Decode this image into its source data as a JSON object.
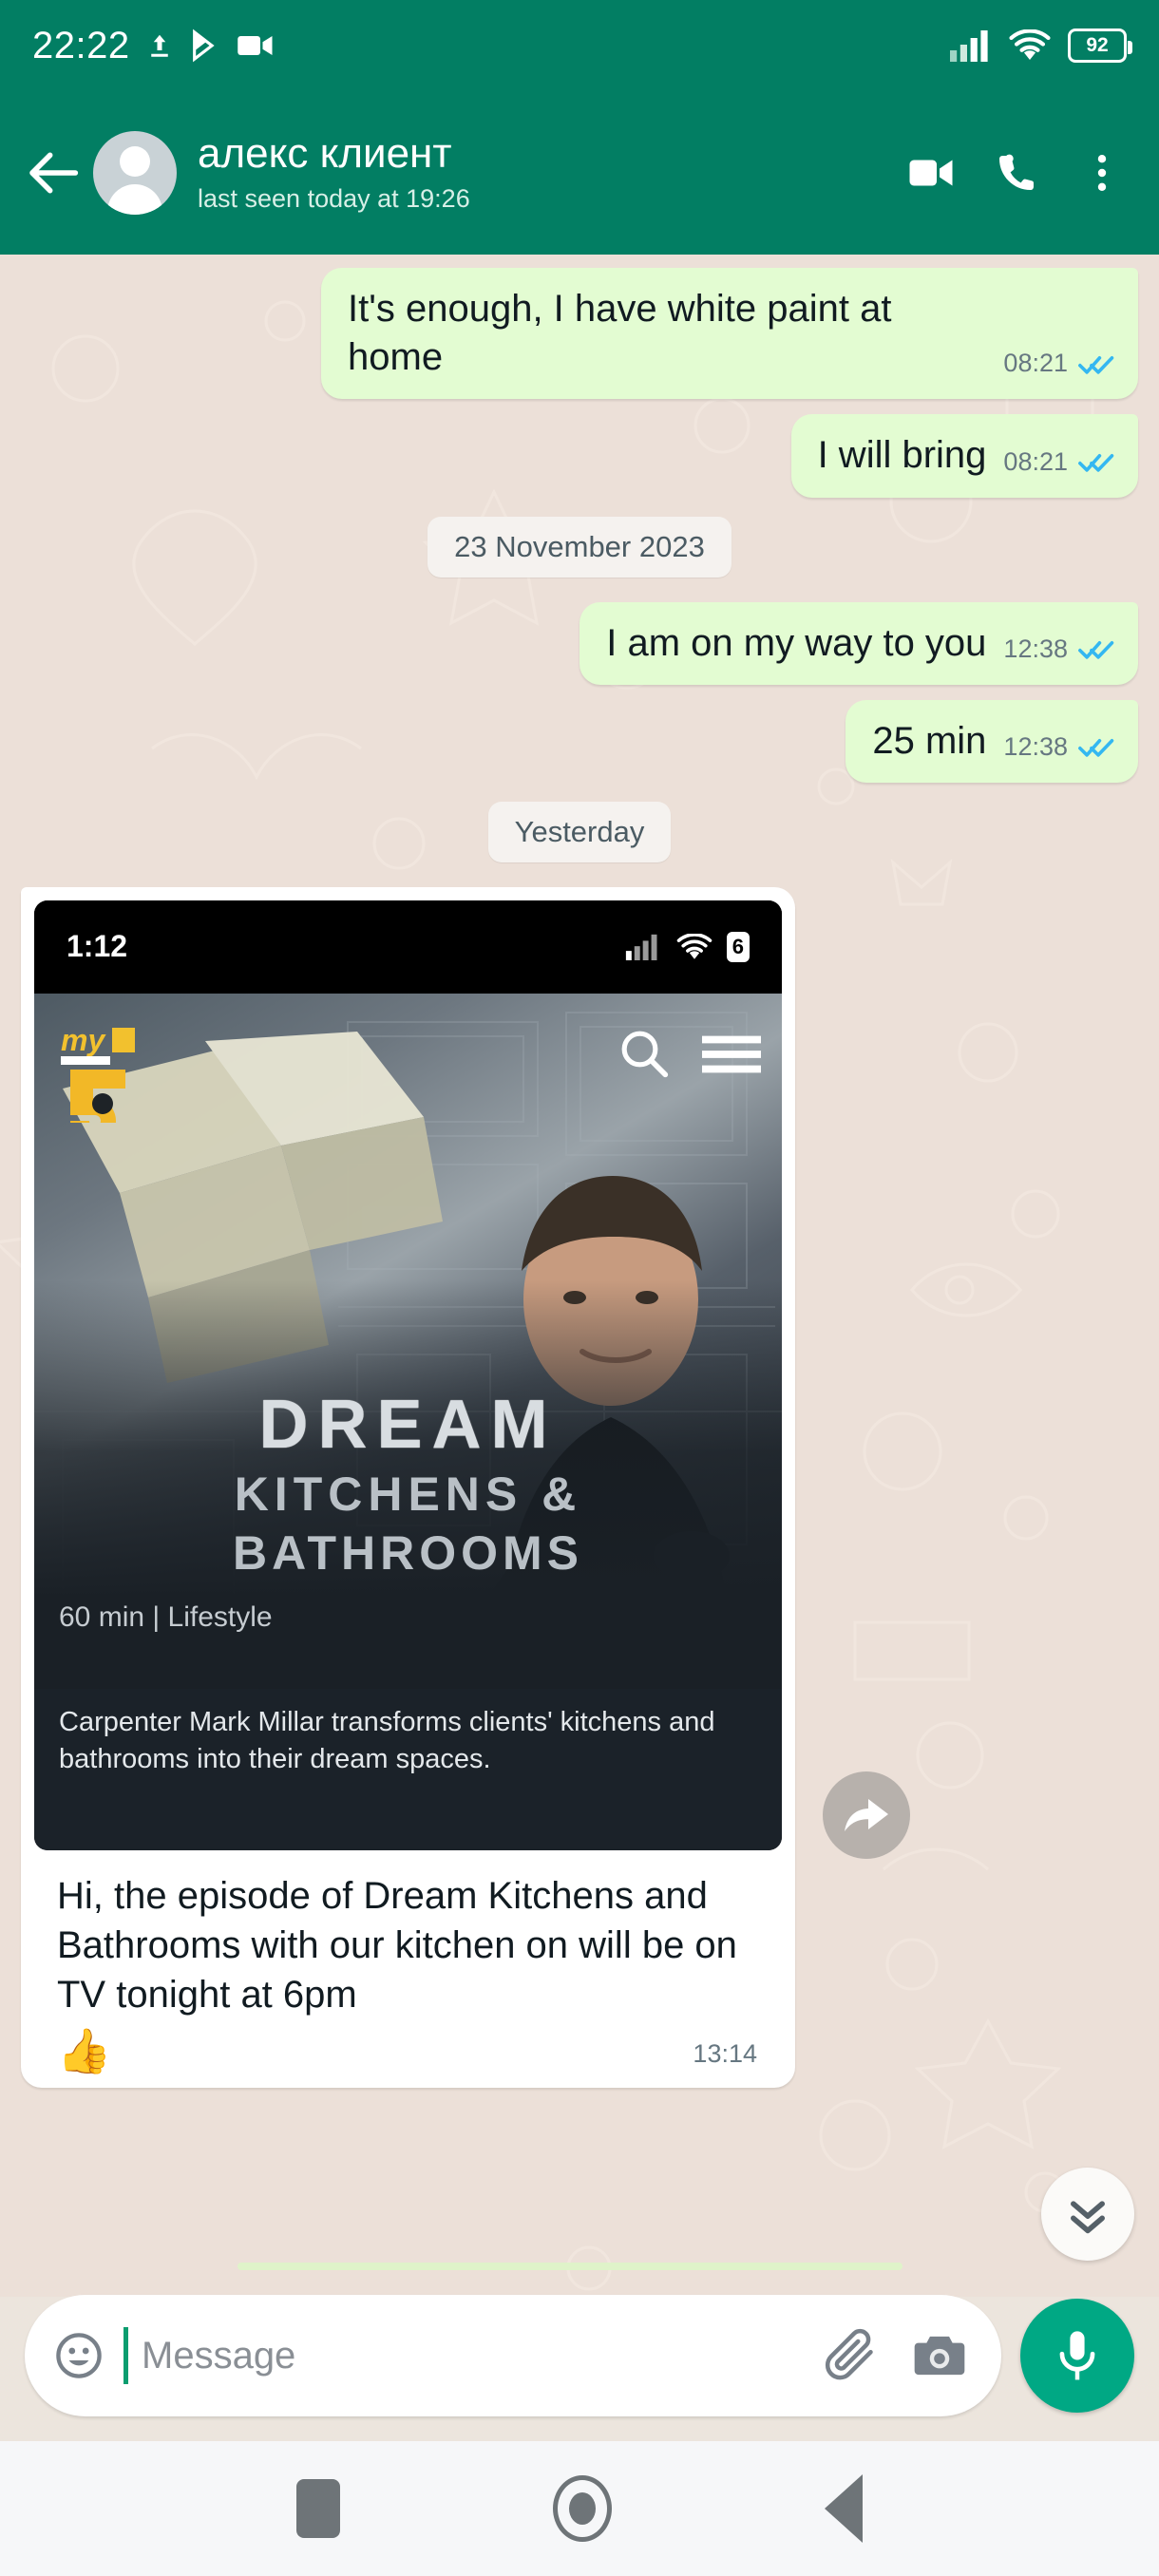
{
  "status_bar": {
    "clock": "22:22",
    "battery": "92",
    "icons": [
      "upload-icon",
      "play-store-icon",
      "video-recording-icon",
      "cellular-signal-icon",
      "wifi-icon",
      "battery-icon"
    ]
  },
  "app_bar": {
    "back_icon": "back-arrow-icon",
    "contact_name": "алекс клиент",
    "contact_status": "last seen today at 19:26",
    "actions": [
      "video-call-icon",
      "voice-call-icon",
      "overflow-menu-icon"
    ]
  },
  "conversation": [
    {
      "kind": "message",
      "side": "out",
      "text": "It's enough, I have white paint at home",
      "time": "08:21",
      "status": "read"
    },
    {
      "kind": "message",
      "side": "out",
      "text": "I will bring",
      "time": "08:21",
      "status": "read"
    },
    {
      "kind": "divider",
      "text": "23 November 2023"
    },
    {
      "kind": "message",
      "side": "out",
      "text": "I am on my way to you",
      "time": "12:38",
      "status": "read"
    },
    {
      "kind": "message",
      "side": "out",
      "text": "25 min",
      "time": "12:38",
      "status": "read"
    },
    {
      "kind": "divider",
      "text": "Yesterday"
    }
  ],
  "media_message": {
    "side": "in",
    "screenshot": {
      "clock": "1:12",
      "battery": "6",
      "brand_logo": "my5-logo",
      "search_icon": "search-icon",
      "menu_icon": "hamburger-menu-icon",
      "title_line1": "DREAM",
      "title_line2": "KITCHENS &",
      "title_line3": "BATHROOMS",
      "meta": "60 min | Lifestyle",
      "description": "Carpenter Mark Millar transforms clients' kitchens and bathrooms into their dream spaces."
    },
    "caption": "Hi, the episode of Dream Kitchens and Bathrooms with our kitchen on will be on TV tonight at 6pm",
    "emoji": "👍",
    "time": "13:14"
  },
  "forward_button": {
    "icon": "forward-arrow-icon"
  },
  "scroll_button": {
    "icon": "double-chevron-down-icon"
  },
  "input_bar": {
    "emoji_icon": "emoji-smiley-icon",
    "placeholder": "Message",
    "value": "",
    "attach_icon": "paperclip-icon",
    "camera_icon": "camera-icon",
    "mic_icon": "microphone-icon"
  },
  "nav_bar": {
    "recents_icon": "recents-square-icon",
    "home_icon": "home-circle-icon",
    "back_icon": "back-triangle-icon"
  },
  "colors": {
    "brand_green": "#027e63",
    "outgoing_bubble": "#e3fcd2",
    "incoming_bubble": "#ffffff",
    "chat_background": "#ece0d8",
    "tick_blue": "#34b7f1",
    "mic_green": "#00a884"
  }
}
